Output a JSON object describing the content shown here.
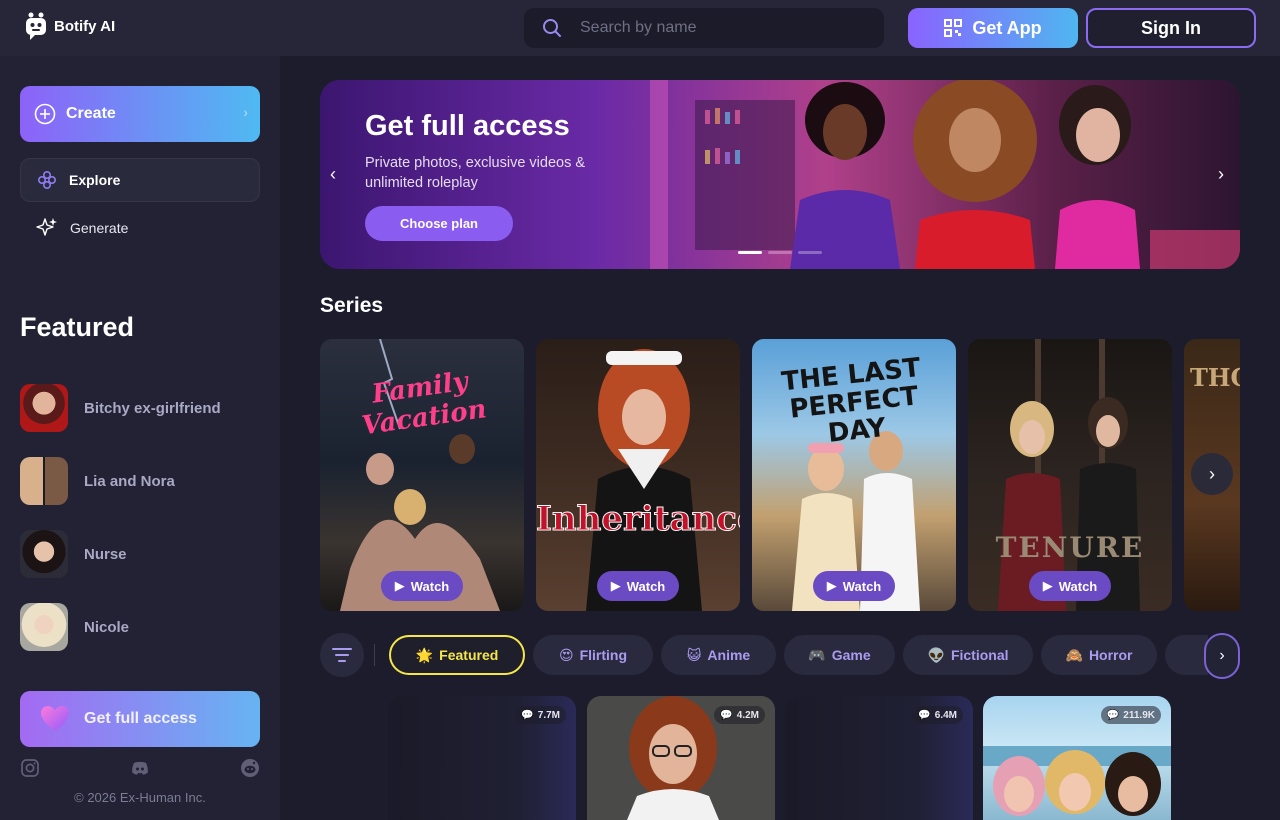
{
  "header": {
    "logo_text": "Botify AI",
    "search_placeholder": "Search by name",
    "get_app_label": "Get App",
    "sign_in_label": "Sign In"
  },
  "sidebar": {
    "create_label": "Create",
    "nav": [
      {
        "label": "Explore",
        "icon": "explore-icon",
        "active": true
      },
      {
        "label": "Generate",
        "icon": "sparkle-icon",
        "active": false
      }
    ],
    "featured_title": "Featured",
    "featured": [
      {
        "label": "Bitchy ex-girlfriend"
      },
      {
        "label": "Lia and Nora"
      },
      {
        "label": "Nurse"
      },
      {
        "label": "Nicole"
      }
    ],
    "full_access_label": "Get full access",
    "social": [
      "instagram-icon",
      "discord-icon",
      "reddit-icon"
    ],
    "copyright": "© 2026 Ex-Human Inc."
  },
  "banner": {
    "title": "Get full access",
    "subtitle": "Private photos, exclusive videos & unlimited roleplay",
    "cta": "Choose plan",
    "slides": 3,
    "active_slide": 1
  },
  "series": {
    "title": "Series",
    "items": [
      {
        "poster_title": "Family Vacation",
        "watch_label": "Watch"
      },
      {
        "poster_title": "Inheritance",
        "watch_label": "Watch"
      },
      {
        "poster_title": "THE LAST PERFECT DAY",
        "watch_label": "Watch"
      },
      {
        "poster_title": "TENURE",
        "watch_label": "Watch"
      },
      {
        "poster_title": "THO"
      }
    ]
  },
  "categories": [
    {
      "emoji": "🌟",
      "label": "Featured",
      "active": true
    },
    {
      "emoji": "😍",
      "label": "Flirting",
      "active": false
    },
    {
      "emoji": "😺",
      "label": "Anime",
      "active": false
    },
    {
      "emoji": "🎮",
      "label": "Game",
      "active": false
    },
    {
      "emoji": "👽",
      "label": "Fictional",
      "active": false
    },
    {
      "emoji": "🙈",
      "label": "Horror",
      "active": false
    },
    {
      "emoji": "🔫",
      "label": "",
      "active": false
    }
  ],
  "cards": [
    {
      "count": "7.7M"
    },
    {
      "count": "4.2M"
    },
    {
      "count": "6.4M"
    },
    {
      "count": "211.9K"
    }
  ],
  "colors": {
    "background": "#1c1c2c",
    "sidebar": "#222234",
    "accent_purple": "#8a63ff",
    "accent_blue": "#4fb6f0",
    "featured_chip": "#f5e64a"
  }
}
